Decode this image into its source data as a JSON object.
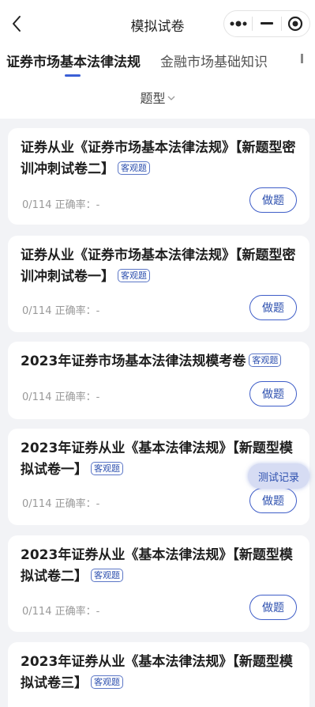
{
  "nav": {
    "title": "模拟试卷"
  },
  "tabs": [
    {
      "label": "证券市场基本法律法规",
      "active": true
    },
    {
      "label": "金融市场基础知识",
      "active": false
    }
  ],
  "filter": {
    "label": "题型"
  },
  "cards": [
    {
      "title": "证券从业《证券市场基本法律法规》【新题型密训冲刺试卷二】",
      "badge": "客观题",
      "progress": "0/114 正确率：-",
      "button": "做题"
    },
    {
      "title": "证券从业《证券市场基本法律法规》【新题型密训冲刺试卷一】",
      "badge": "客观题",
      "progress": "0/114 正确率：-",
      "button": "做题"
    },
    {
      "title": "2023年证券市场基本法律法规模考卷",
      "badge": "客观题",
      "progress": "0/114 正确率：-",
      "button": "做题"
    },
    {
      "title": "2023年证券从业《基本法律法规》【新题型模拟试卷一】",
      "badge": "客观题",
      "progress": "0/114 正确率：-",
      "button": "做题"
    },
    {
      "title": "2023年证券从业《基本法律法规》【新题型模拟试卷二】",
      "badge": "客观题",
      "progress": "0/114 正确率：-",
      "button": "做题"
    },
    {
      "title": "2023年证券从业《基本法律法规》【新题型模拟试卷三】",
      "badge": "客观题",
      "progress": "",
      "button": ""
    }
  ],
  "float_button": {
    "label": "测试记录"
  },
  "icons": {
    "back": "chevron-left-icon",
    "more": "more-dots-icon",
    "minimize": "minus-icon",
    "close": "target-icon",
    "filter": "chevron-down-icon"
  },
  "colors": {
    "accent": "#3b5fd6",
    "background": "#f2f3f6"
  }
}
